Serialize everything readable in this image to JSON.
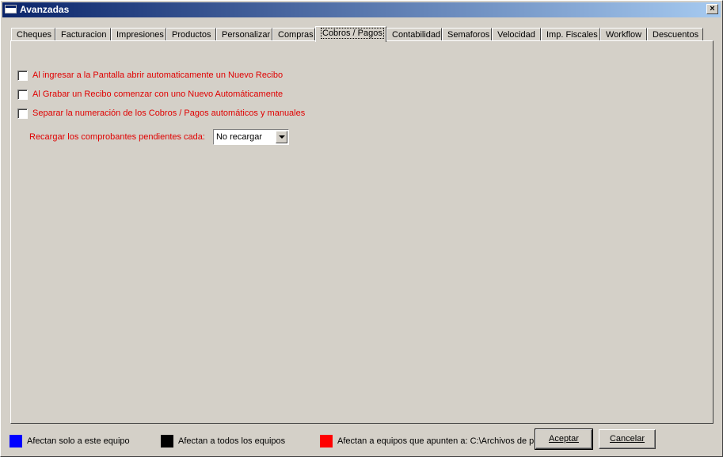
{
  "window": {
    "title": "Avanzadas",
    "close": "×"
  },
  "tabs": [
    {
      "label": "Cheques"
    },
    {
      "label": "Facturacion"
    },
    {
      "label": "Impresiones"
    },
    {
      "label": "Productos"
    },
    {
      "label": "Personalizar"
    },
    {
      "label": "Compras"
    },
    {
      "label": "Cobros / Pagos",
      "active": true
    },
    {
      "label": "Contabilidad"
    },
    {
      "label": "Semaforos"
    },
    {
      "label": "Velocidad"
    },
    {
      "label": "Imp. Fiscales"
    },
    {
      "label": "Workflow"
    },
    {
      "label": "Descuentos"
    }
  ],
  "options": [
    {
      "label": "Al ingresar a la Pantalla abrir automaticamente un Nuevo Recibo",
      "checked": false
    },
    {
      "label": "Al Grabar un Recibo comenzar con uno Nuevo Automáticamente",
      "checked": false
    },
    {
      "label": "Separar la numeración de los Cobros / Pagos automáticos y manuales",
      "checked": false
    }
  ],
  "reload": {
    "label": "Recargar los comprobantes pendientes cada:",
    "value": "No recargar"
  },
  "legend": [
    {
      "label": "Afectan solo a este equipo",
      "color": "#0000ff"
    },
    {
      "label": "Afectan a todos los equipos",
      "color": "#000000"
    },
    {
      "label": "Afectan a equipos que apunten a: C:\\Archivos de p",
      "color": "#ff0000"
    }
  ],
  "buttons": {
    "accept": "Aceptar",
    "cancel": "Cancelar"
  },
  "colors": {
    "option_text": "#e00000",
    "title_start": "#0a246a",
    "title_end": "#a6caf0"
  }
}
